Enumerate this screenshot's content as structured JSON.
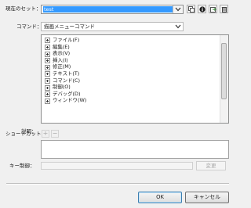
{
  "current_set": {
    "label": "現在のセット：",
    "value": "test"
  },
  "toolbar_icons": [
    "duplicate-set-icon",
    "info-icon",
    "import-icon",
    "delete-set-icon"
  ],
  "commands": {
    "label": "コマンド：",
    "value": "描画メニューコマンド"
  },
  "tree": {
    "items": [
      {
        "label": "ファイル(F)"
      },
      {
        "label": "編集(E)"
      },
      {
        "label": "表示(V)"
      },
      {
        "label": "挿入(I)"
      },
      {
        "label": "修正(M)"
      },
      {
        "label": "テキスト(T)"
      },
      {
        "label": "コマンド(C)"
      },
      {
        "label": "制御(O)"
      },
      {
        "label": "デバッグ(D)"
      },
      {
        "label": "ウィンドウ(W)"
      }
    ]
  },
  "description": {
    "label": "説明："
  },
  "shortcuts": {
    "label": "ショートカット：",
    "add_label": "+",
    "remove_label": "−"
  },
  "key_press": {
    "label": "キー制御：",
    "value": ""
  },
  "change_button": "変更",
  "ok_button": "OK",
  "cancel_button": "キャンセル"
}
